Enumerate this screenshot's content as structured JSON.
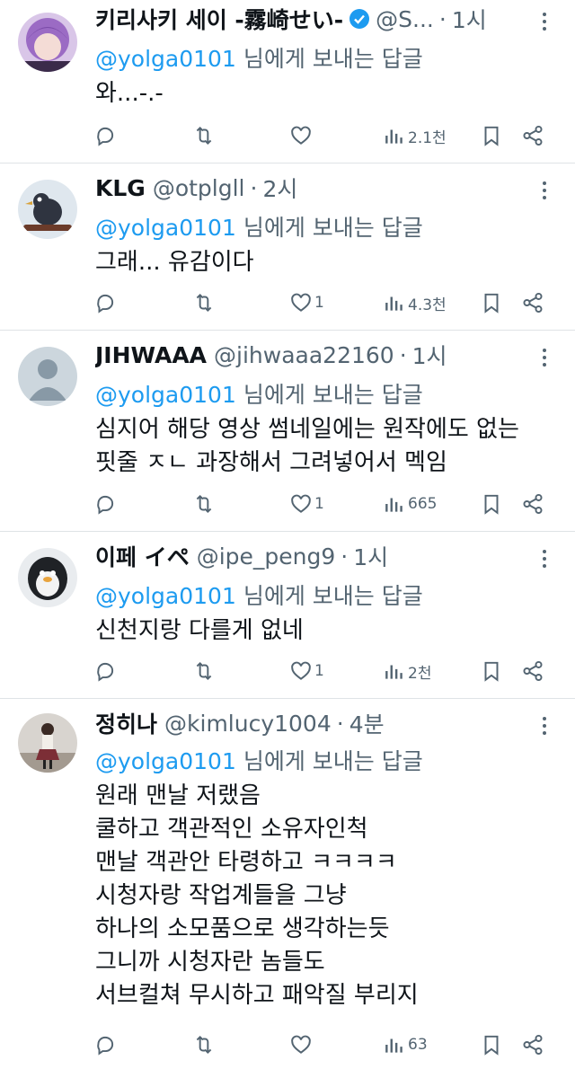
{
  "reply_prefix_mention": "@yolga0101",
  "reply_prefix_text": "님에게 보내는 답글",
  "tweets": [
    {
      "name": "키리사키 세이 -霧崎せい-",
      "verified": true,
      "handle": "@S...",
      "time": "1시",
      "lines": [
        "와...-.-"
      ],
      "replies": "",
      "retweets": "",
      "likes": "",
      "views": "2.1천"
    },
    {
      "name": "KLG",
      "verified": false,
      "handle": "@otplgll",
      "time": "2시",
      "lines": [
        "그래... 유감이다"
      ],
      "replies": "",
      "retweets": "",
      "likes": "1",
      "views": "4.3천"
    },
    {
      "name": "JIHWAAA",
      "verified": false,
      "handle": "@jihwaaa22160",
      "time": "1시",
      "lines": [
        "심지어 해당 영상 썸네일에는 원작에도 없는",
        "핏줄 ㅈㄴ 과장해서 그려넣어서 멕임"
      ],
      "replies": "",
      "retweets": "",
      "likes": "1",
      "views": "665"
    },
    {
      "name": "이페 イペ",
      "verified": false,
      "handle": "@ipe_peng9",
      "time": "1시",
      "lines": [
        "신천지랑 다를게 없네"
      ],
      "replies": "",
      "retweets": "",
      "likes": "1",
      "views": "2천"
    },
    {
      "name": "정히나",
      "verified": false,
      "handle": "@kimlucy1004",
      "time": "4분",
      "lines": [
        "원래 맨날 저랬음",
        "쿨하고 객관적인 소유자인척",
        "맨날 객관안 타령하고 ㅋㅋㅋㅋ",
        "시청자랑 작업계들을 그냥",
        "하나의 소모품으로 생각하는듯",
        "그니까 시청자란 놈들도",
        "서브컬쳐 무시하고 패악질 부리지"
      ],
      "replies": "",
      "retweets": "",
      "likes": "",
      "views": "63"
    }
  ],
  "icons": {
    "reply": "reply-icon",
    "retweet": "retweet-icon",
    "like": "heart-icon",
    "views": "views-chart-icon",
    "bookmark": "bookmark-icon",
    "share": "share-icon",
    "more": "more-dots-icon",
    "verified": "verified-badge-icon"
  },
  "colors": {
    "mention": "#1d9bf0",
    "secondary_text": "#536471",
    "primary_text": "#0f1419",
    "divider": "#dfe3e6"
  }
}
